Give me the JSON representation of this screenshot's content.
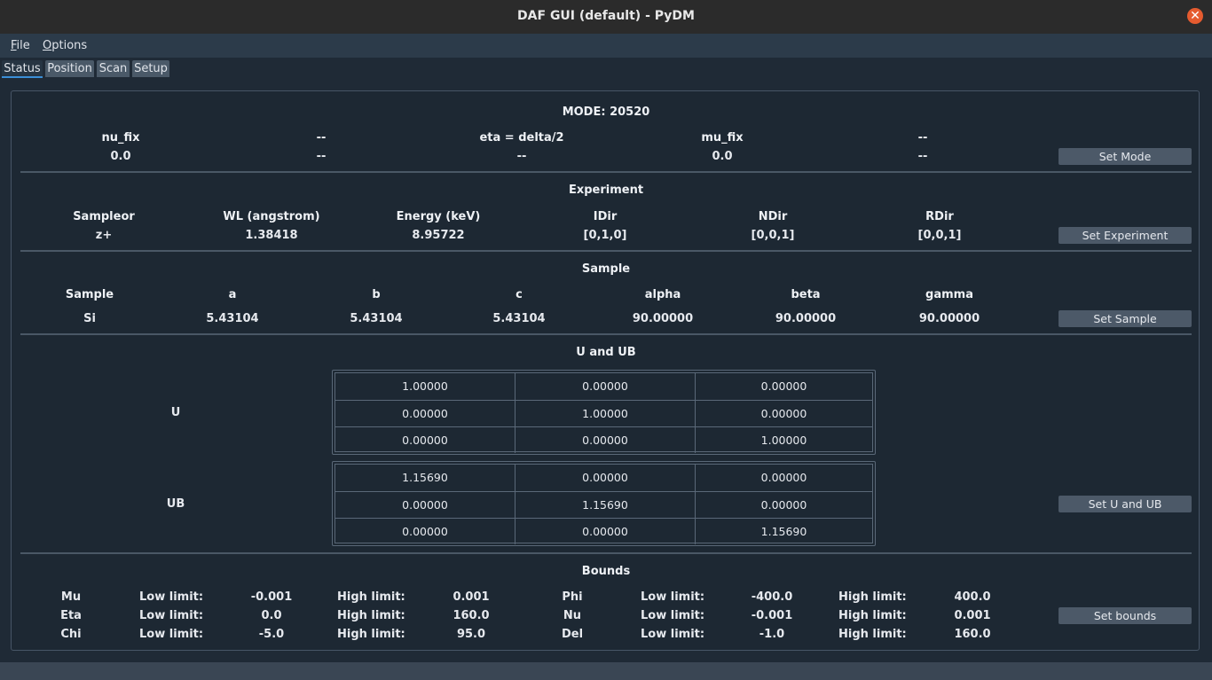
{
  "window": {
    "title": "DAF GUI (default) - PyDM"
  },
  "menu": [
    {
      "label_u": "F",
      "label_rest": "ile"
    },
    {
      "label_u": "O",
      "label_rest": "ptions"
    }
  ],
  "tabs": [
    "Status",
    "Position",
    "Scan",
    "Setup"
  ],
  "mode": {
    "title": "MODE: 20520",
    "headers": [
      "nu_fix",
      "--",
      "eta = delta/2",
      "mu_fix",
      "--"
    ],
    "values": [
      "0.0",
      "--",
      "--",
      "0.0",
      "--"
    ],
    "button": "Set Mode"
  },
  "experiment": {
    "title": "Experiment",
    "headers": [
      "Sampleor",
      "WL (angstrom)",
      "Energy (keV)",
      "IDir",
      "NDir",
      "RDir"
    ],
    "values": [
      "z+",
      "1.38418",
      "8.95722",
      "[0,1,0]",
      "[0,0,1]",
      "[0,0,1]"
    ],
    "button": "Set Experiment"
  },
  "sample": {
    "title": "Sample",
    "headers": [
      "Sample",
      "a",
      "b",
      "c",
      "alpha",
      "beta",
      "gamma"
    ],
    "values": [
      "Si",
      "5.43104",
      "5.43104",
      "5.43104",
      "90.00000",
      "90.00000",
      "90.00000"
    ],
    "button": "Set Sample"
  },
  "ub": {
    "title": "U and UB",
    "u_label": "U",
    "ub_label": "UB",
    "u": [
      [
        "1.00000",
        "0.00000",
        "0.00000"
      ],
      [
        "0.00000",
        "1.00000",
        "0.00000"
      ],
      [
        "0.00000",
        "0.00000",
        "1.00000"
      ]
    ],
    "ub_matrix": [
      [
        "1.15690",
        "0.00000",
        "0.00000"
      ],
      [
        "0.00000",
        "1.15690",
        "0.00000"
      ],
      [
        "0.00000",
        "0.00000",
        "1.15690"
      ]
    ],
    "button": "Set U and UB"
  },
  "bounds": {
    "title": "Bounds",
    "low_label": "Low limit:",
    "high_label": "High limit:",
    "left": [
      {
        "name": "Mu",
        "low": "-0.001",
        "high": "0.001"
      },
      {
        "name": "Eta",
        "low": "0.0",
        "high": "160.0"
      },
      {
        "name": "Chi",
        "low": "-5.0",
        "high": "95.0"
      }
    ],
    "right": [
      {
        "name": "Phi",
        "low": "-400.0",
        "high": "400.0"
      },
      {
        "name": "Nu",
        "low": "-0.001",
        "high": "0.001"
      },
      {
        "name": "Del",
        "low": "-1.0",
        "high": "160.0"
      }
    ],
    "button": "Set bounds"
  },
  "colors": {
    "accent": "#3b8fd8",
    "close": "#e55b2f",
    "background": "#1d2833"
  }
}
